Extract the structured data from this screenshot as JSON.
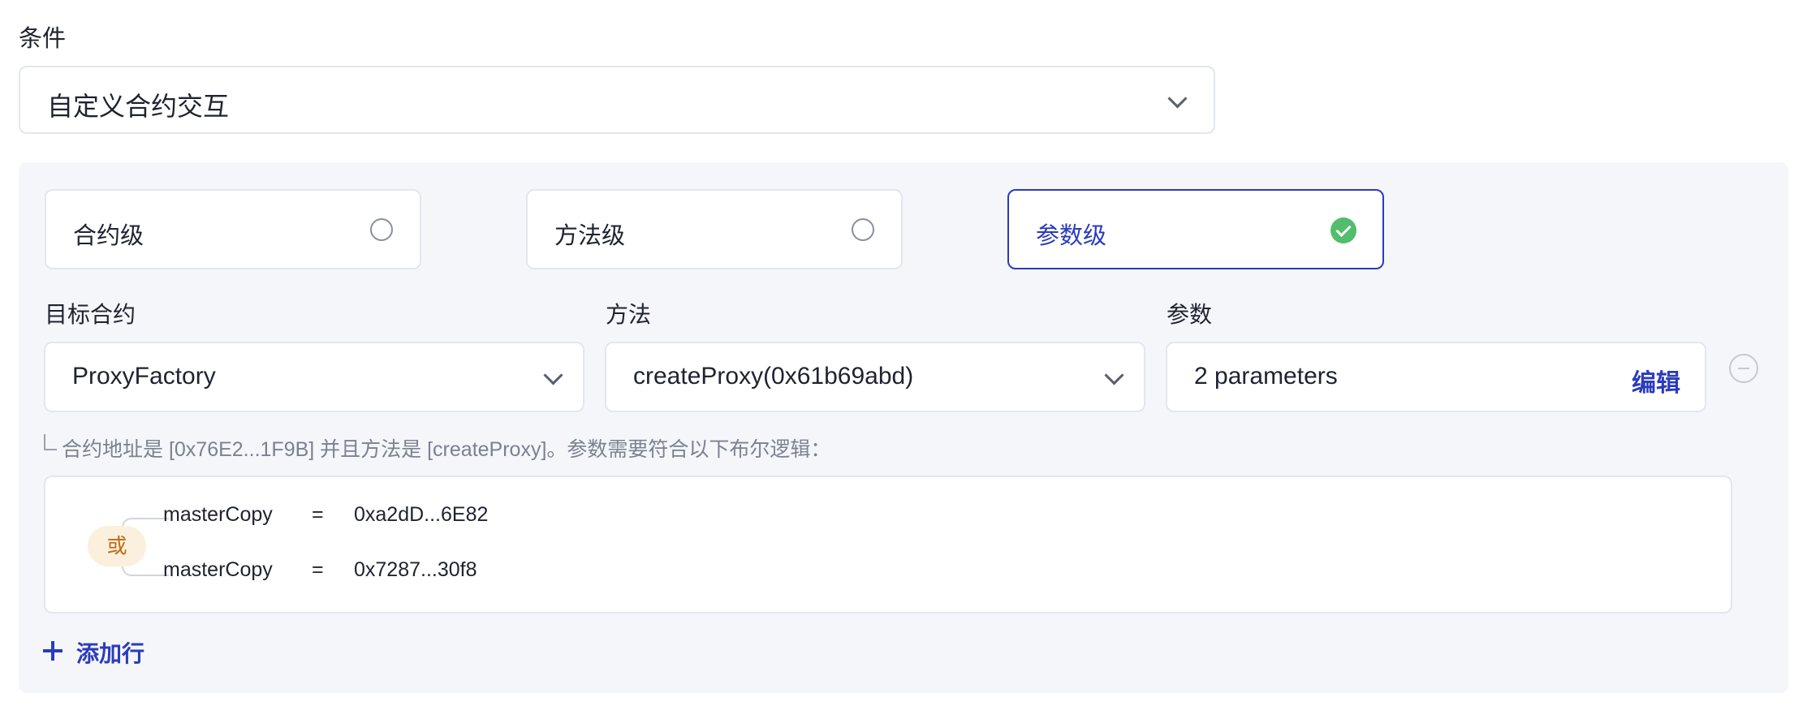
{
  "condition": {
    "label": "条件",
    "selected": "自定义合约交互"
  },
  "levels": [
    {
      "label": "合约级",
      "selected": false
    },
    {
      "label": "方法级",
      "selected": false
    },
    {
      "label": "参数级",
      "selected": true
    }
  ],
  "fields": {
    "target_contract": {
      "label": "目标合约",
      "value": "ProxyFactory"
    },
    "method": {
      "label": "方法",
      "value": "createProxy(0x61b69abd)"
    },
    "params": {
      "label": "参数",
      "value": "2 parameters",
      "edit_label": "编辑"
    }
  },
  "hint": "合约地址是 [0x76E2...1F9B] 并且方法是 [createProxy]。参数需要符合以下布尔逻辑：",
  "logic": {
    "operator": "或",
    "conditions": [
      {
        "param": "masterCopy",
        "op": "=",
        "value": "0xa2dD...6E82"
      },
      {
        "param": "masterCopy",
        "op": "=",
        "value": "0x7287...30f8"
      }
    ]
  },
  "add_row_label": "添加行",
  "colors": {
    "accent": "#2b3bbd",
    "success": "#52bd6c",
    "panel_bg": "#f5f6fa",
    "or_badge_bg": "#fbf0dd",
    "or_badge_text": "#bf6a16"
  },
  "icons": {
    "dropdown": "chevron-down-icon",
    "radio_unchecked": "radio-unchecked-icon",
    "radio_checked": "check-circle-icon",
    "remove": "minus-circle-icon",
    "add": "plus-icon"
  }
}
